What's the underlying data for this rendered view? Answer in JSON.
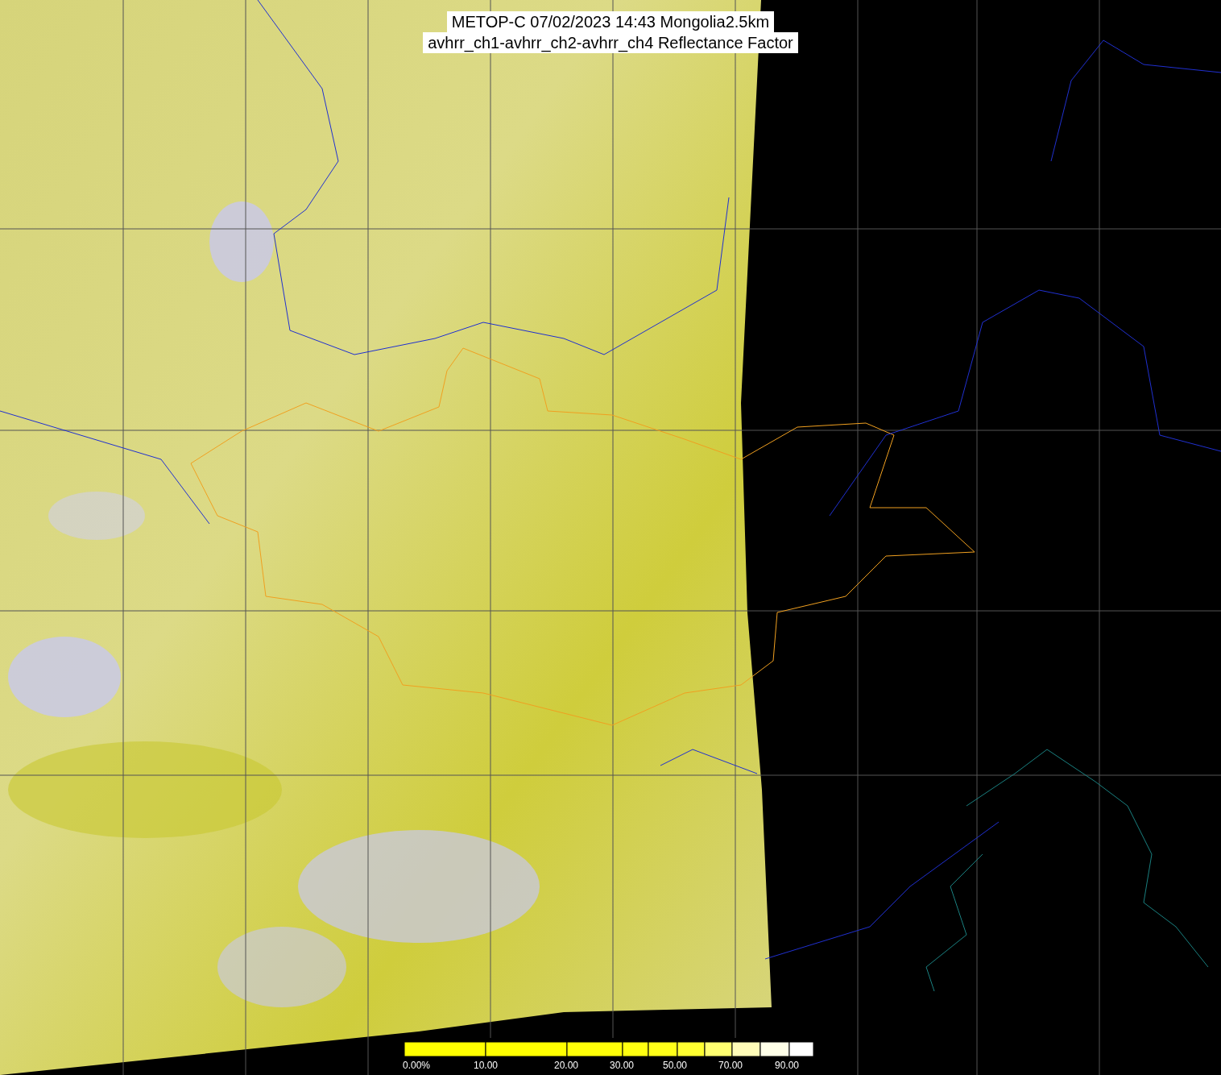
{
  "title": {
    "lines": [
      "METOP-C 07/02/2023 14:43 Mongolia2.5km",
      "avhrr_ch1-avhrr_ch2-avhrr_ch4 Reflectance Factor"
    ]
  },
  "colorbar": {
    "labels": [
      "0.00%",
      "10.00",
      "20.00",
      "30.00",
      "50.00",
      "70.00",
      "90.00"
    ]
  }
}
